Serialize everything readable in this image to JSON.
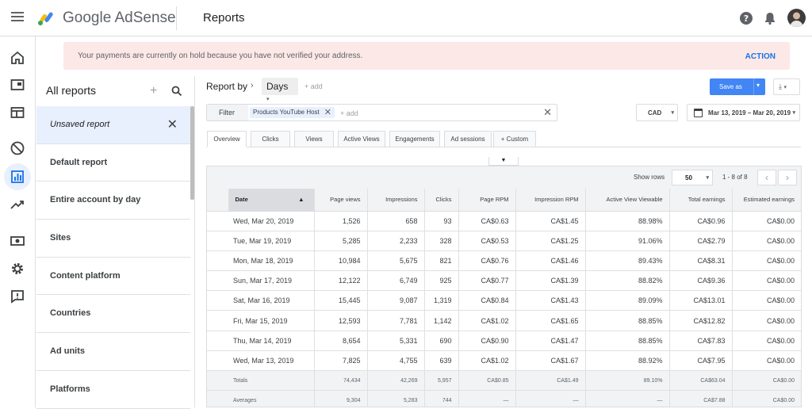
{
  "app": {
    "brand": "Google AdSense",
    "page_title": "Reports"
  },
  "colors": {
    "accent": "#1a73e8",
    "banner_bg": "#fce8e6",
    "selected": "#e8f0fe",
    "button": "#4285f4"
  },
  "banner": {
    "message": "Your payments are currently on hold because you have not verified your address.",
    "action": "ACTION"
  },
  "rail": {
    "icons": [
      "home-icon",
      "display-icon",
      "ad-units-icon",
      "block-icon",
      "reports-icon",
      "trending-icon",
      "payments-icon",
      "settings-icon",
      "feedback-icon"
    ],
    "selected": "reports-icon"
  },
  "reports_panel": {
    "title": "All reports",
    "items": [
      {
        "label": "Unsaved report",
        "selected": true
      },
      {
        "label": "Default report"
      },
      {
        "label": "Entire account by day"
      },
      {
        "label": "Sites"
      },
      {
        "label": "Content platform"
      },
      {
        "label": "Countries"
      },
      {
        "label": "Ad units"
      },
      {
        "label": "Platforms"
      }
    ]
  },
  "toolbar": {
    "report_by": "Report by",
    "dimension": "Days",
    "add": "+ add",
    "save_label": "Save as",
    "filter_label": "Filter",
    "filter_chip_prefix": "Products",
    "filter_chip_value": "YouTube Host",
    "filter_add": "+ add",
    "currency": "CAD",
    "date_range": "Mar 13, 2019 – Mar 20, 2019"
  },
  "tabs": [
    "Overview",
    "Clicks",
    "Views",
    "Active Views",
    "Engagements",
    "Ad sessions",
    "+ Custom"
  ],
  "table": {
    "show_rows_label": "Show rows",
    "rows_per_page": "50",
    "pagination": "1 - 8 of 8",
    "columns": [
      "Date",
      "Page views",
      "Impressions",
      "Clicks",
      "Page RPM",
      "Impression RPM",
      "Active View Viewable",
      "Total earnings",
      "Estimated earnings"
    ],
    "rows": [
      [
        "Wed, Mar 20, 2019",
        "1,526",
        "658",
        "93",
        "CA$0.63",
        "CA$1.45",
        "88.98%",
        "CA$0.96",
        "CA$0.00"
      ],
      [
        "Tue, Mar 19, 2019",
        "5,285",
        "2,233",
        "328",
        "CA$0.53",
        "CA$1.25",
        "91.06%",
        "CA$2.79",
        "CA$0.00"
      ],
      [
        "Mon, Mar 18, 2019",
        "10,984",
        "5,675",
        "821",
        "CA$0.76",
        "CA$1.46",
        "89.43%",
        "CA$8.31",
        "CA$0.00"
      ],
      [
        "Sun, Mar 17, 2019",
        "12,122",
        "6,749",
        "925",
        "CA$0.77",
        "CA$1.39",
        "88.82%",
        "CA$9.36",
        "CA$0.00"
      ],
      [
        "Sat, Mar 16, 2019",
        "15,445",
        "9,087",
        "1,319",
        "CA$0.84",
        "CA$1.43",
        "89.09%",
        "CA$13.01",
        "CA$0.00"
      ],
      [
        "Fri, Mar 15, 2019",
        "12,593",
        "7,781",
        "1,142",
        "CA$1.02",
        "CA$1.65",
        "88.85%",
        "CA$12.82",
        "CA$0.00"
      ],
      [
        "Thu, Mar 14, 2019",
        "8,654",
        "5,331",
        "690",
        "CA$0.90",
        "CA$1.47",
        "88.85%",
        "CA$7.83",
        "CA$0.00"
      ],
      [
        "Wed, Mar 13, 2019",
        "7,825",
        "4,755",
        "639",
        "CA$1.02",
        "CA$1.67",
        "88.92%",
        "CA$7.95",
        "CA$0.00"
      ]
    ],
    "totals": [
      "Totals",
      "74,434",
      "42,269",
      "5,957",
      "CA$0.85",
      "CA$1.49",
      "89.10%",
      "CA$63.04",
      "CA$0.00"
    ],
    "averages": [
      "Averages",
      "9,304",
      "5,283",
      "744",
      "—",
      "—",
      "—",
      "CA$7.88",
      "CA$0.00"
    ]
  }
}
